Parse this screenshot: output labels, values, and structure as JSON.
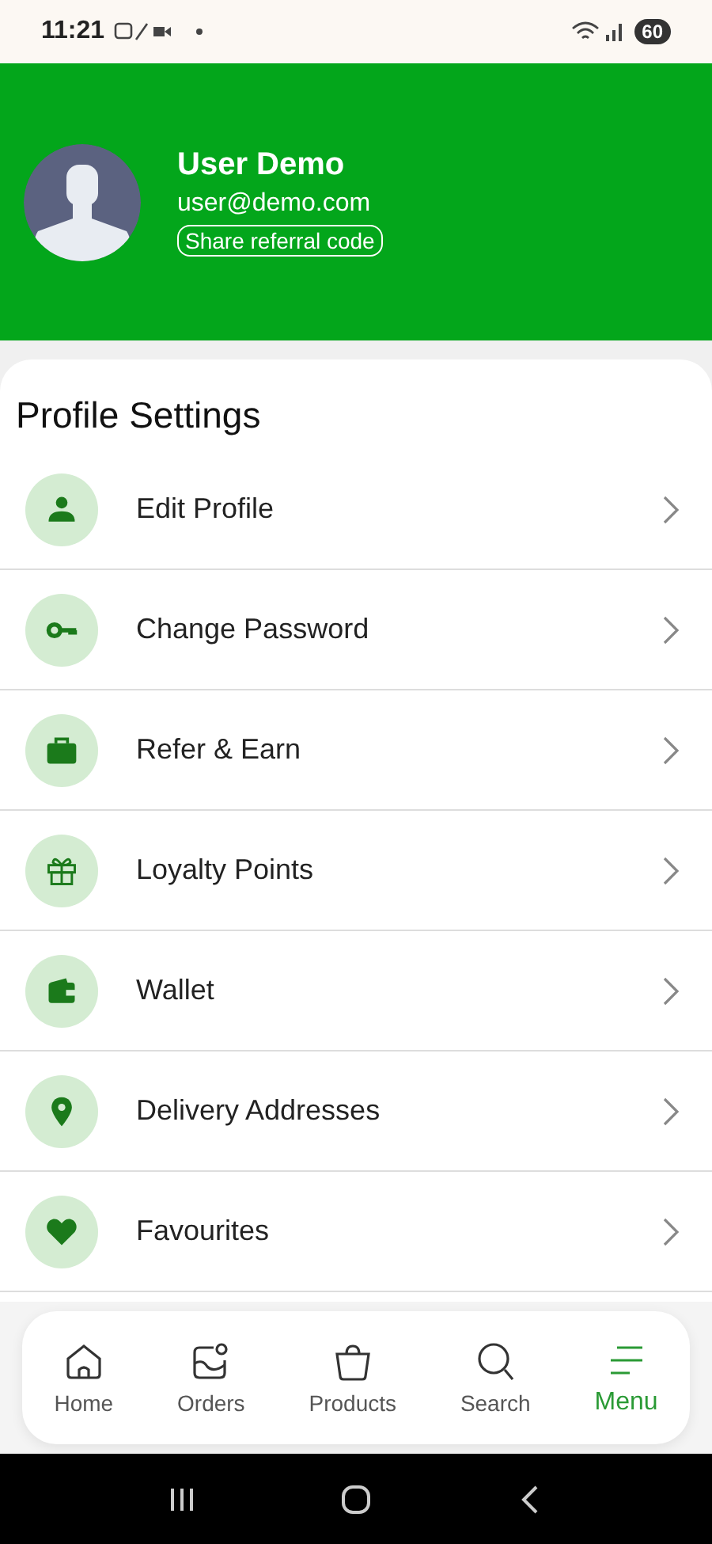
{
  "status_bar": {
    "time": "11:21",
    "battery": "60"
  },
  "profile": {
    "name": "User Demo",
    "email": "user@demo.com",
    "referral_button": "Share referral code"
  },
  "section_title": "Profile Settings",
  "items": [
    {
      "label": "Edit Profile"
    },
    {
      "label": "Change Password"
    },
    {
      "label": "Refer & Earn"
    },
    {
      "label": "Loyalty Points"
    },
    {
      "label": "Wallet"
    },
    {
      "label": "Delivery Addresses"
    },
    {
      "label": "Favourites"
    }
  ],
  "bottom_nav": [
    {
      "label": "Home",
      "selected": false
    },
    {
      "label": "Orders",
      "selected": false
    },
    {
      "label": "Products",
      "selected": false
    },
    {
      "label": "Search",
      "selected": false
    },
    {
      "label": "Menu",
      "selected": true
    }
  ]
}
